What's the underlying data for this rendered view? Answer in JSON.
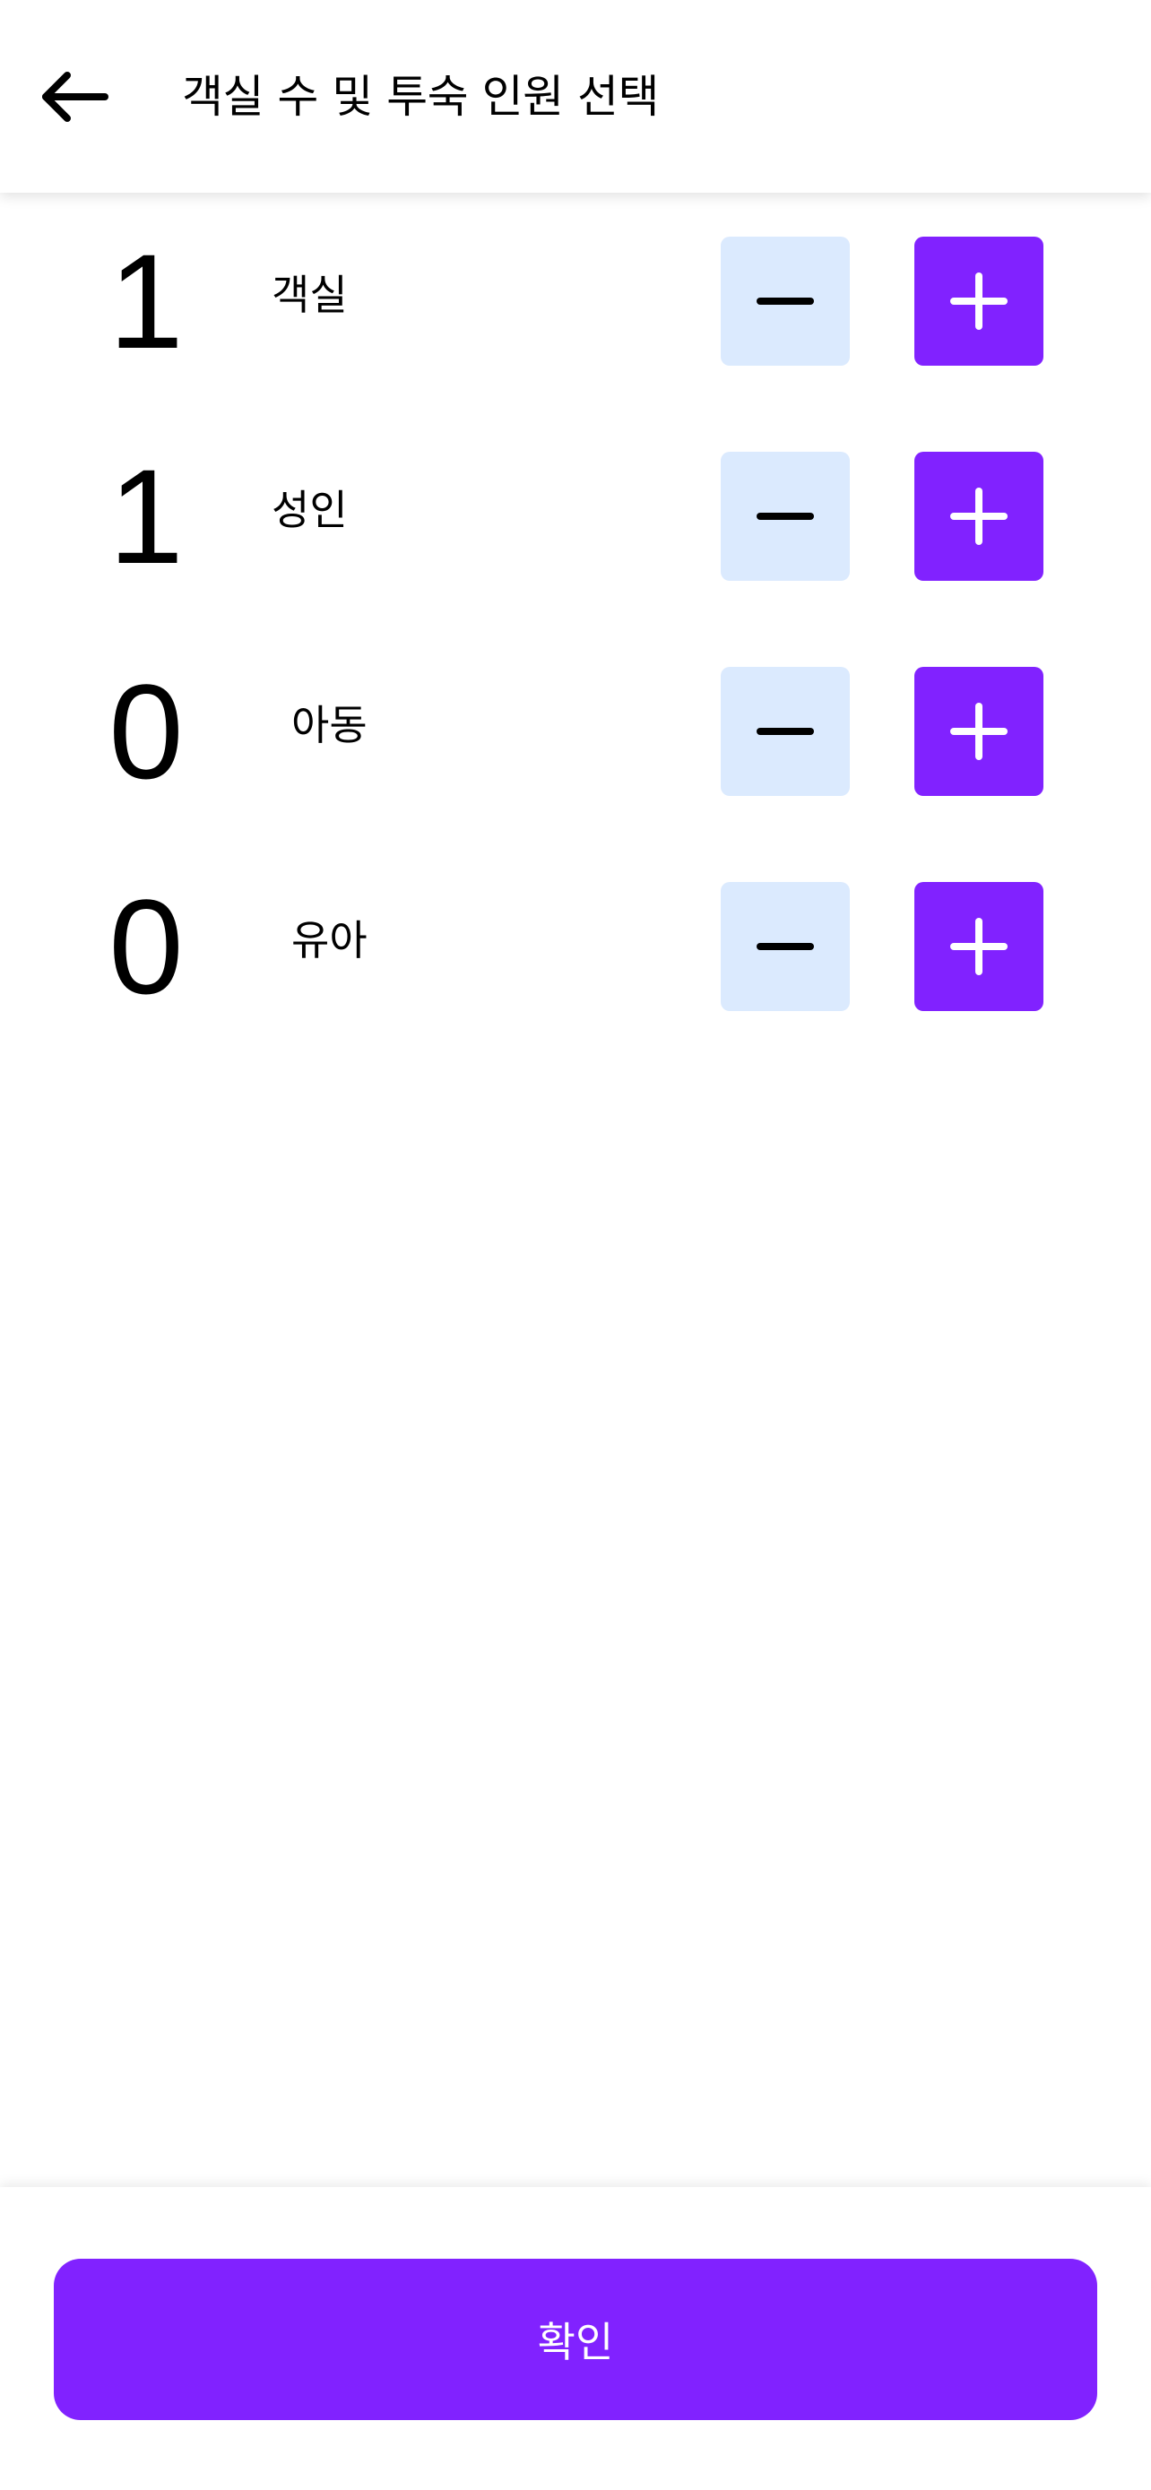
{
  "header": {
    "title": "객실 수 및 투숙 인원 선택",
    "back_icon": "arrow-left-icon"
  },
  "counters": [
    {
      "key": "rooms",
      "count": "1",
      "label": "객실"
    },
    {
      "key": "adults",
      "count": "1",
      "label": "성인"
    },
    {
      "key": "children",
      "count": "0",
      "label": "아동"
    },
    {
      "key": "infants",
      "count": "0",
      "label": "유아"
    }
  ],
  "icons": {
    "decrement": "minus-icon",
    "increment": "plus-icon"
  },
  "footer": {
    "confirm_label": "확인"
  },
  "colors": {
    "accent": "#8122ff",
    "decrement_bg": "#dbeafe",
    "text": "#000000",
    "background": "#ffffff"
  }
}
